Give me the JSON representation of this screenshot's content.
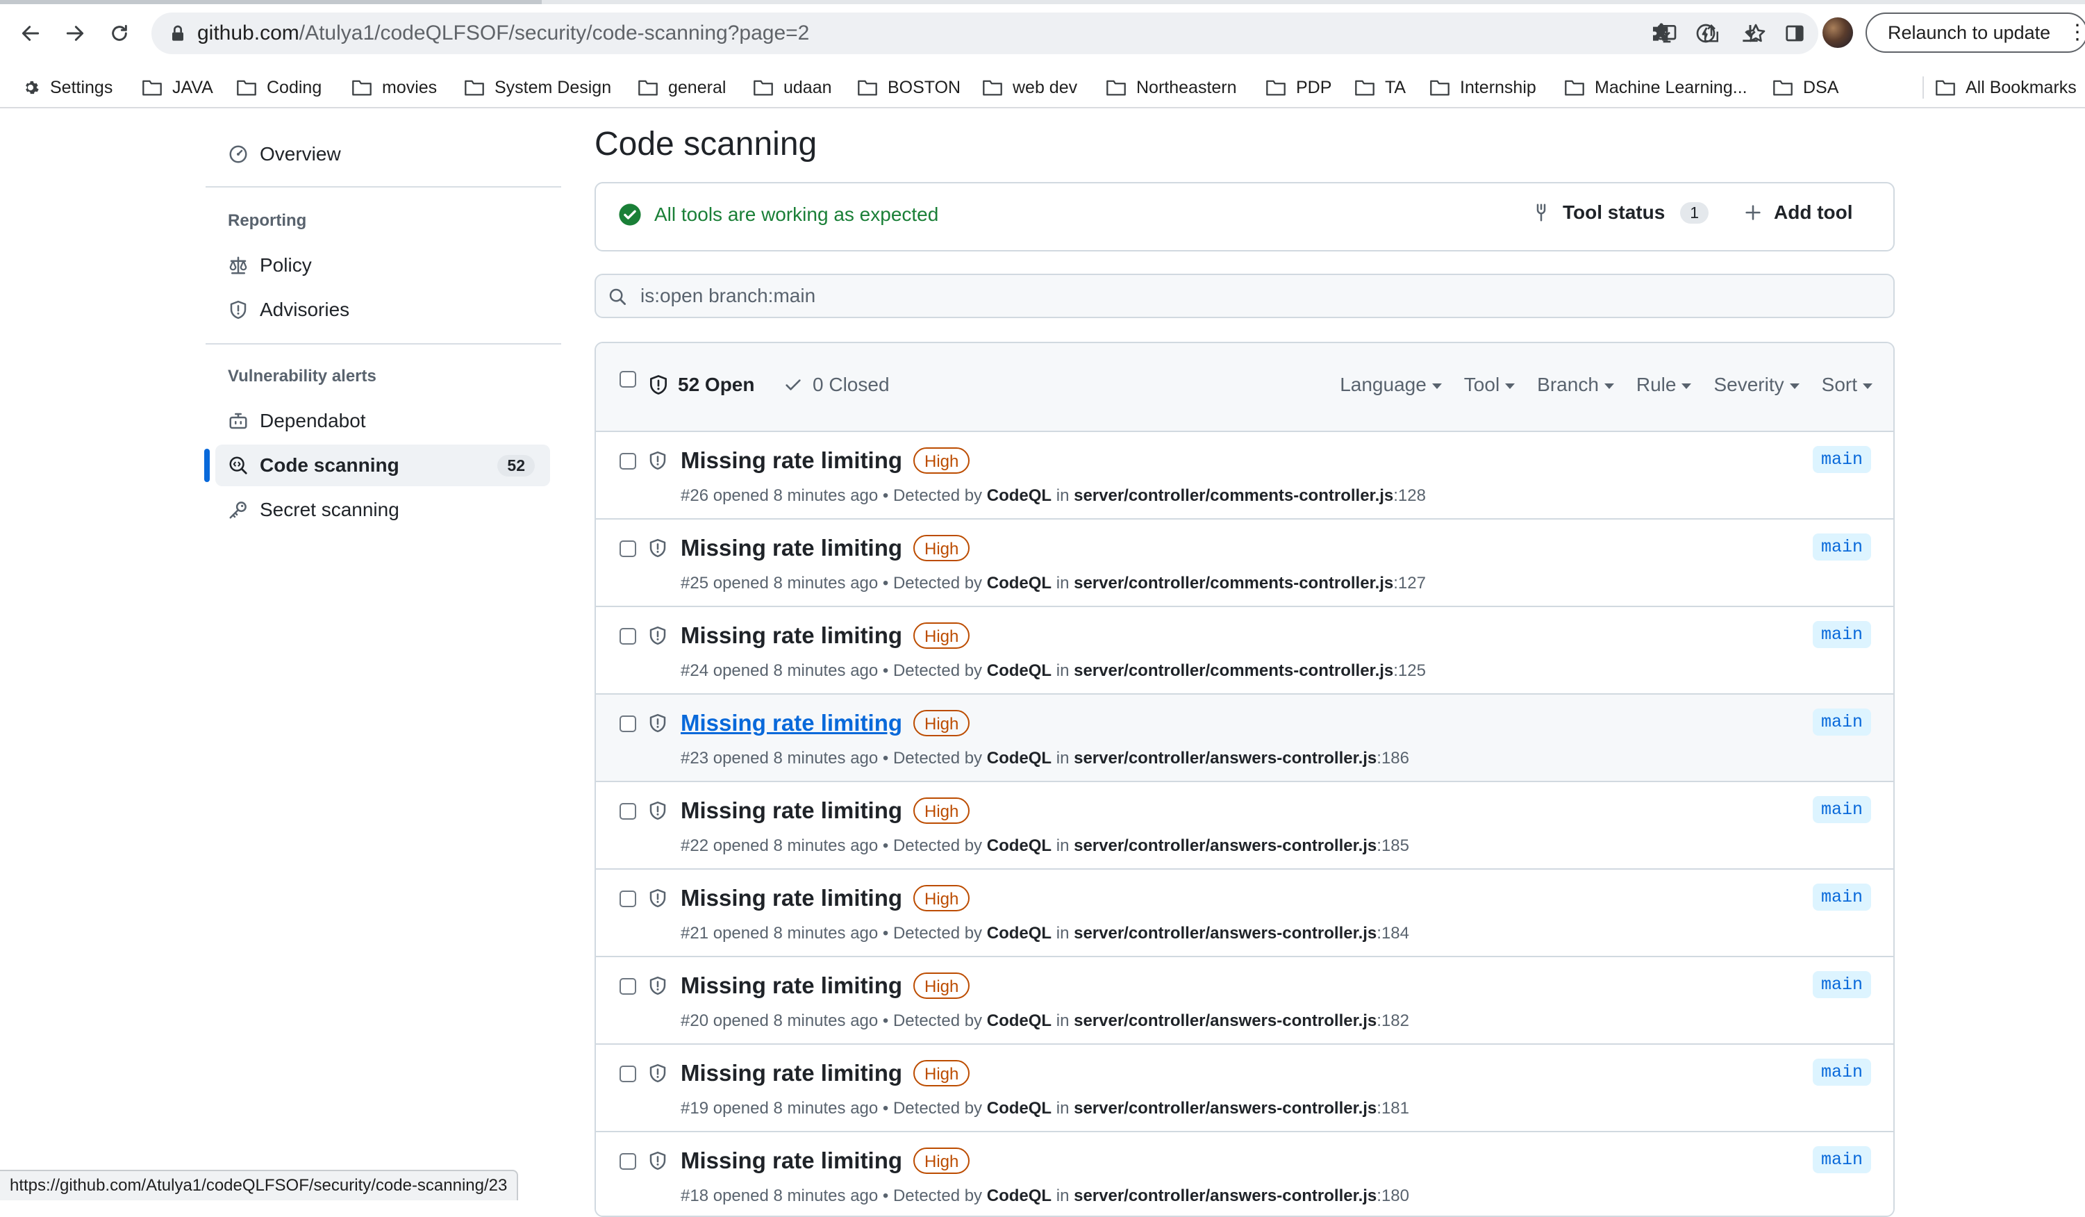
{
  "browser": {
    "url_host": "github.com",
    "url_path": "/Atulya1/codeQLFSOF/security/code-scanning?page=2",
    "relaunch_label": "Relaunch to update",
    "status_url": "https://github.com/Atulya1/codeQLFSOF/security/code-scanning/23"
  },
  "bookmarks": [
    {
      "label": "Settings",
      "icon": "gear-icon"
    },
    {
      "label": "JAVA",
      "icon": "folder-icon"
    },
    {
      "label": "Coding",
      "icon": "folder-icon"
    },
    {
      "label": "movies",
      "icon": "folder-icon"
    },
    {
      "label": "System Design",
      "icon": "folder-icon"
    },
    {
      "label": "general",
      "icon": "folder-icon"
    },
    {
      "label": "udaan",
      "icon": "folder-icon"
    },
    {
      "label": "BOSTON",
      "icon": "folder-icon"
    },
    {
      "label": "web dev",
      "icon": "folder-icon"
    },
    {
      "label": "Northeastern",
      "icon": "folder-icon"
    },
    {
      "label": "PDP",
      "icon": "folder-icon"
    },
    {
      "label": "TA",
      "icon": "folder-icon"
    },
    {
      "label": "Internship",
      "icon": "folder-icon"
    },
    {
      "label": "Machine Learning...",
      "icon": "folder-icon"
    },
    {
      "label": "DSA",
      "icon": "folder-icon"
    }
  ],
  "all_bookmarks_label": "All Bookmarks",
  "sidebar": {
    "overview": "Overview",
    "reporting_heading": "Reporting",
    "policy": "Policy",
    "advisories": "Advisories",
    "vuln_heading": "Vulnerability alerts",
    "dependabot": "Dependabot",
    "code_scanning": "Code scanning",
    "code_scanning_count": "52",
    "secret_scanning": "Secret scanning"
  },
  "main": {
    "title": "Code scanning",
    "status_text": "All tools are working as expected",
    "tool_status_label": "Tool status",
    "tool_status_count": "1",
    "add_tool_label": "Add tool",
    "search_value": "is:open branch:main",
    "open_label": "52 Open",
    "closed_label": "0 Closed",
    "filters": [
      "Language",
      "Tool",
      "Branch",
      "Rule",
      "Severity",
      "Sort"
    ]
  },
  "alerts": [
    {
      "title": "Missing rate limiting",
      "severity": "High",
      "number": "#26",
      "opened": "opened 8 minutes ago",
      "detected_prefix": "• Detected by",
      "tool": "CodeQL",
      "in": "in",
      "path": "server/controller/comments-controller.js",
      "line": ":128",
      "branch": "main"
    },
    {
      "title": "Missing rate limiting",
      "severity": "High",
      "number": "#25",
      "opened": "opened 8 minutes ago",
      "detected_prefix": "• Detected by",
      "tool": "CodeQL",
      "in": "in",
      "path": "server/controller/comments-controller.js",
      "line": ":127",
      "branch": "main"
    },
    {
      "title": "Missing rate limiting",
      "severity": "High",
      "number": "#24",
      "opened": "opened 8 minutes ago",
      "detected_prefix": "• Detected by",
      "tool": "CodeQL",
      "in": "in",
      "path": "server/controller/comments-controller.js",
      "line": ":125",
      "branch": "main"
    },
    {
      "title": "Missing rate limiting",
      "severity": "High",
      "number": "#23",
      "opened": "opened 8 minutes ago",
      "detected_prefix": "• Detected by",
      "tool": "CodeQL",
      "in": "in",
      "path": "server/controller/answers-controller.js",
      "line": ":186",
      "branch": "main"
    },
    {
      "title": "Missing rate limiting",
      "severity": "High",
      "number": "#22",
      "opened": "opened 8 minutes ago",
      "detected_prefix": "• Detected by",
      "tool": "CodeQL",
      "in": "in",
      "path": "server/controller/answers-controller.js",
      "line": ":185",
      "branch": "main"
    },
    {
      "title": "Missing rate limiting",
      "severity": "High",
      "number": "#21",
      "opened": "opened 8 minutes ago",
      "detected_prefix": "• Detected by",
      "tool": "CodeQL",
      "in": "in",
      "path": "server/controller/answers-controller.js",
      "line": ":184",
      "branch": "main"
    },
    {
      "title": "Missing rate limiting",
      "severity": "High",
      "number": "#20",
      "opened": "opened 8 minutes ago",
      "detected_prefix": "• Detected by",
      "tool": "CodeQL",
      "in": "in",
      "path": "server/controller/answers-controller.js",
      "line": ":182",
      "branch": "main"
    },
    {
      "title": "Missing rate limiting",
      "severity": "High",
      "number": "#19",
      "opened": "opened 8 minutes ago",
      "detected_prefix": "• Detected by",
      "tool": "CodeQL",
      "in": "in",
      "path": "server/controller/answers-controller.js",
      "line": ":181",
      "branch": "main"
    },
    {
      "title": "Missing rate limiting",
      "severity": "High",
      "number": "#18",
      "opened": "opened 8 minutes ago",
      "detected_prefix": "• Detected by",
      "tool": "CodeQL",
      "in": "in",
      "path": "server/controller/answers-controller.js",
      "line": ":180",
      "branch": "main"
    }
  ],
  "colors": {
    "accent": "#0969da",
    "success": "#1a7f37",
    "severity_high": "#bc4c00",
    "branch_bg": "#ddf4ff"
  }
}
